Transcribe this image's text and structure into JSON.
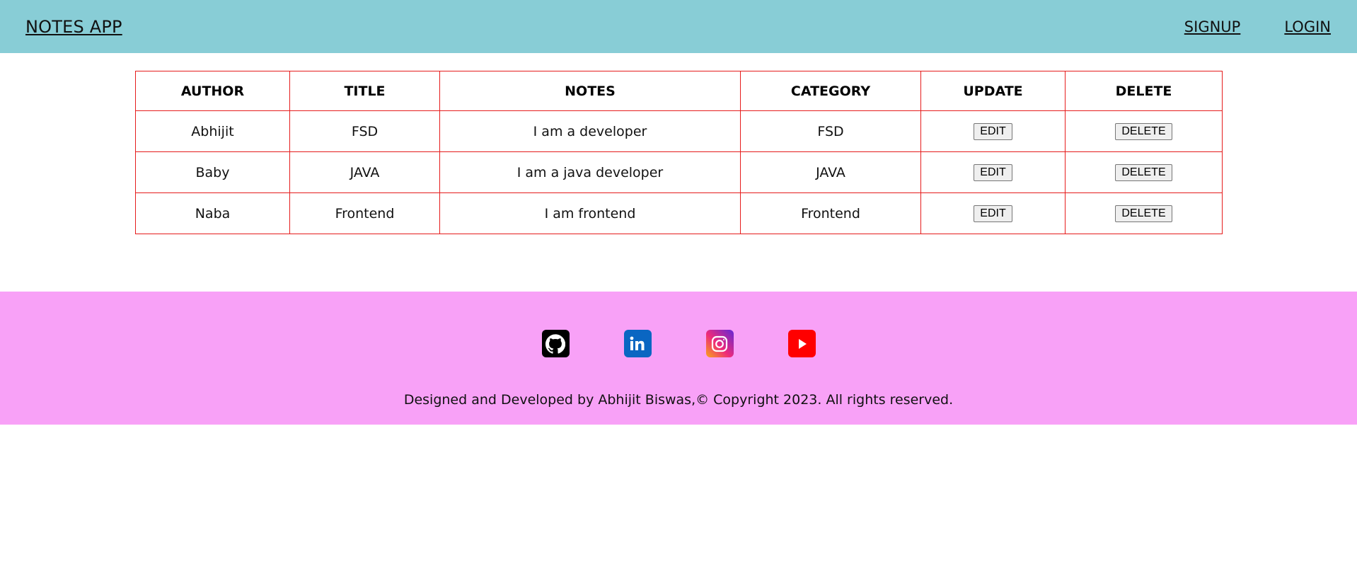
{
  "navbar": {
    "brand": "NOTES APP",
    "links": [
      "SIGNUP",
      "LOGIN"
    ]
  },
  "table": {
    "headers": [
      "AUTHOR",
      "TITLE",
      "NOTES",
      "CATEGORY",
      "UPDATE",
      "DELETE"
    ],
    "rows": [
      {
        "author": "Abhijit",
        "title": "FSD",
        "notes": "I am a developer",
        "category": "FSD",
        "edit_label": "EDIT",
        "delete_label": "DELETE"
      },
      {
        "author": "Baby",
        "title": "JAVA",
        "notes": "I am a java developer",
        "category": "JAVA",
        "edit_label": "EDIT",
        "delete_label": "DELETE"
      },
      {
        "author": "Naba",
        "title": "Frontend",
        "notes": "I am frontend",
        "category": "Frontend",
        "edit_label": "EDIT",
        "delete_label": "DELETE"
      }
    ]
  },
  "footer": {
    "social": [
      {
        "icon": "github-icon",
        "color": "#000000"
      },
      {
        "icon": "linkedin-icon",
        "color": "#0a66c2"
      },
      {
        "icon": "instagram-icon",
        "color": "#ee2a7b"
      },
      {
        "icon": "youtube-icon",
        "color": "#ff0000"
      }
    ],
    "copyright": "Designed and Developed by Abhijit Biswas,© Copyright 2023. All rights reserved."
  },
  "colors": {
    "navbar_bg": "#88cdd6",
    "footer_bg": "#f8a1f7",
    "table_border": "#e61c1c"
  }
}
